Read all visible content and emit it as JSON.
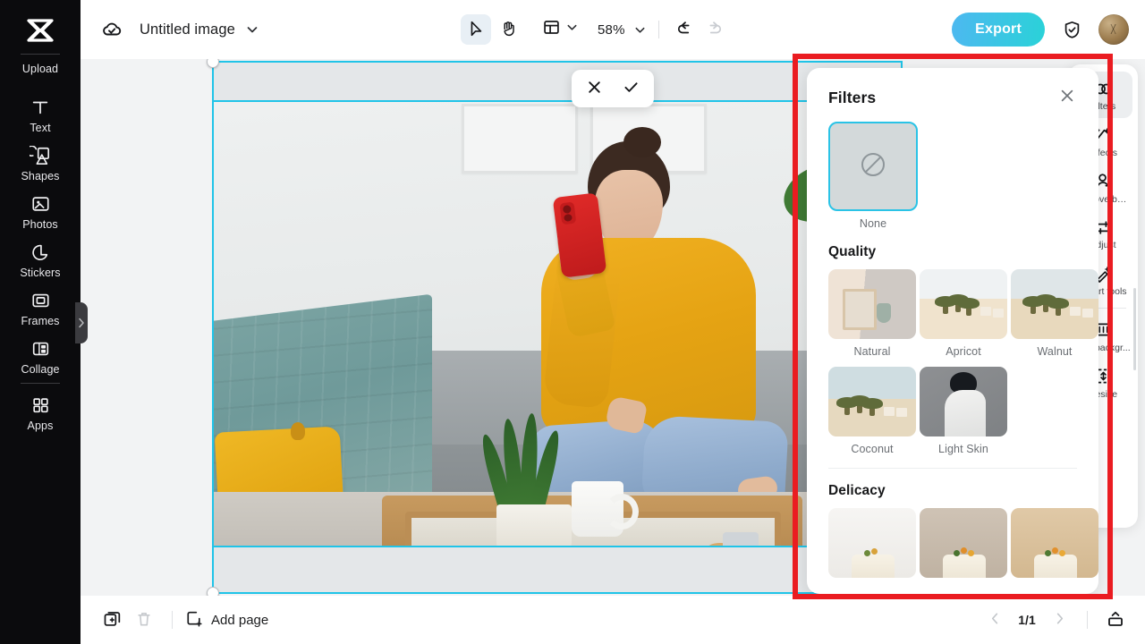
{
  "app": {
    "logo_icon": "capcut-logo-icon",
    "accent_cyan": "#2ac3e6",
    "annotation_color": "#ea1c21"
  },
  "left_sidebar": {
    "items": [
      {
        "label": "Upload",
        "icon": "cloud-upload-icon"
      },
      {
        "label": "Text",
        "icon": "text-t-icon"
      },
      {
        "label": "Shapes",
        "icon": "shapes-icon"
      },
      {
        "label": "Photos",
        "icon": "photo-image-icon"
      },
      {
        "label": "Stickers",
        "icon": "sticker-icon"
      },
      {
        "label": "Frames",
        "icon": "frame-icon"
      },
      {
        "label": "Collage",
        "icon": "collage-layout-icon"
      },
      {
        "label": "Apps",
        "icon": "apps-grid-icon"
      }
    ],
    "collapse_tab_icon": "chevron-right-icon"
  },
  "topbar": {
    "cloud_icon": "cloud-check-icon",
    "document_title": "Untitled image",
    "title_chevron_icon": "chevron-down-icon",
    "tools": [
      {
        "name": "select-tool",
        "icon": "cursor-arrow-icon",
        "active": true
      },
      {
        "name": "pan-tool",
        "icon": "hand-icon",
        "active": false
      }
    ],
    "layout_icon": "layout-panels-icon",
    "layout_chevron_icon": "chevron-down-icon",
    "zoom_value": "58%",
    "zoom_chevron_icon": "chevron-down-icon",
    "undo_icon": "undo-arrow-icon",
    "redo_icon": "redo-arrow-icon",
    "undo_enabled": "true",
    "redo_enabled": "false",
    "export_label": "Export",
    "shield_icon": "shield-check-icon",
    "avatar_label": "user-avatar"
  },
  "canvas": {
    "crop_bar": {
      "cancel_icon": "close-x-icon",
      "confirm_icon": "check-icon"
    },
    "selection": {
      "handle_icon": "resize-handle-icon",
      "border_color": "#20c4e8"
    },
    "photo_description": "woman in yellow sweater sitting cross-legged on grey couch holding red phone"
  },
  "right_sidebar": {
    "items": [
      {
        "label": "Filters",
        "icon": "filters-icon",
        "active": true
      },
      {
        "label": "Effects",
        "icon": "effects-sparkle-icon",
        "active": false
      },
      {
        "label": "Remove backgr...",
        "icon": "remove-background-icon",
        "active": false
      },
      {
        "label": "Adjust",
        "icon": "adjust-sliders-icon",
        "active": false
      },
      {
        "label": "Smart tools",
        "icon": "smart-tools-icon",
        "active": false
      },
      {
        "label": "Add backgr...",
        "icon": "background-icon",
        "active": false
      },
      {
        "label": "Resize",
        "icon": "resize-icon",
        "active": false
      }
    ]
  },
  "filters_panel": {
    "title": "Filters",
    "close_icon": "close-x-icon",
    "none": {
      "label": "None",
      "icon": "no-filter-slash-icon",
      "selected": true
    },
    "sections": [
      {
        "title": "Quality",
        "filters": [
          {
            "label": "Natural",
            "thumb": "interior-mirror-vase"
          },
          {
            "label": "Apricot",
            "thumb": "desert-palms-bright"
          },
          {
            "label": "Walnut",
            "thumb": "desert-palms-cool"
          },
          {
            "label": "Coconut",
            "thumb": "desert-palms-teal"
          },
          {
            "label": "Light Skin",
            "thumb": "woman-white-blouse"
          }
        ]
      },
      {
        "title": "Delicacy",
        "filters": [
          {
            "label": "",
            "thumb": "cake-light"
          },
          {
            "label": "",
            "thumb": "cake-mid"
          },
          {
            "label": "",
            "thumb": "cake-warm"
          }
        ]
      }
    ]
  },
  "bottombar": {
    "duplicate_page_icon": "duplicate-page-icon",
    "delete_page_icon": "trash-icon",
    "add_page_icon": "add-page-plus-icon",
    "add_page_label": "Add page",
    "prev_page_icon": "chevron-left-icon",
    "page_count": "1/1",
    "next_page_icon": "chevron-right-icon",
    "panel_toggle_icon": "panel-collapse-icon"
  }
}
